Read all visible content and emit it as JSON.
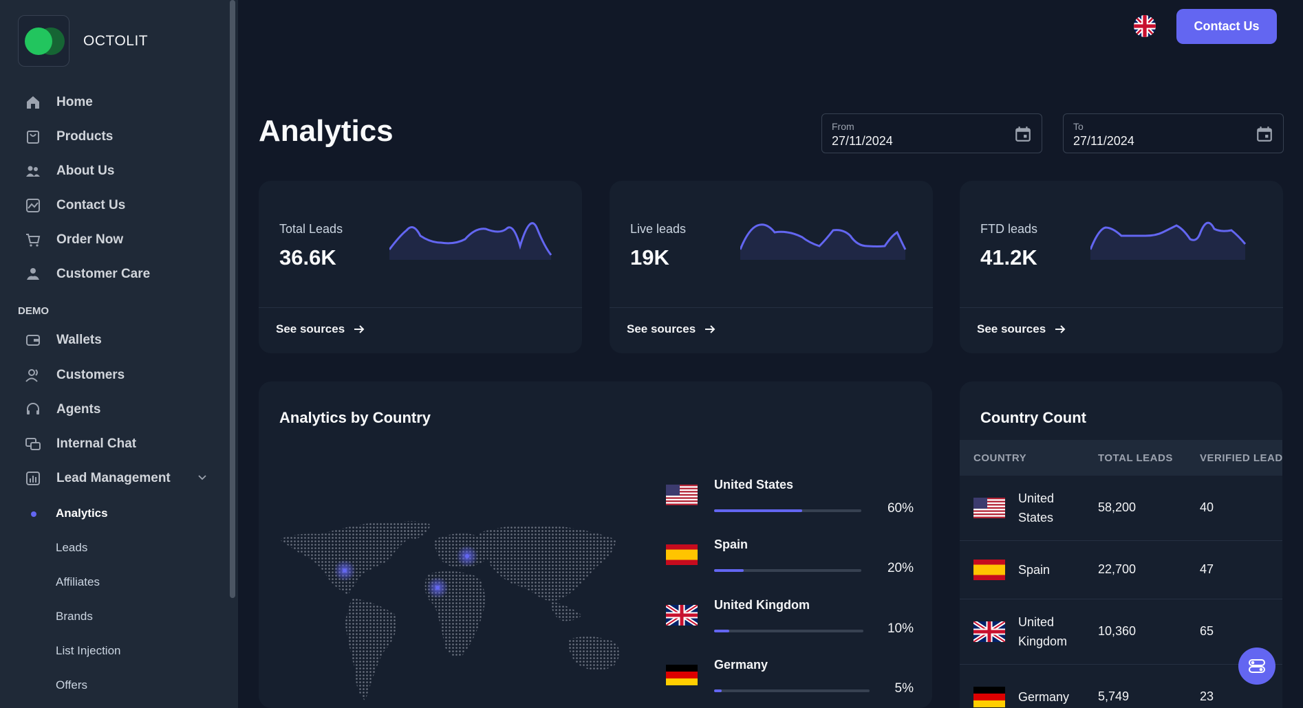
{
  "brand": {
    "name": "OCTOLIT"
  },
  "sidebar": {
    "main_items": [
      {
        "label": "Home",
        "icon": "home-icon"
      },
      {
        "label": "Products",
        "icon": "bag-icon"
      },
      {
        "label": "About Us",
        "icon": "users-icon"
      },
      {
        "label": "Contact Us",
        "icon": "chart-image-icon"
      },
      {
        "label": "Order Now",
        "icon": "cart-icon"
      },
      {
        "label": "Customer Care",
        "icon": "care-icon"
      }
    ],
    "section_label": "DEMO",
    "demo_items": [
      {
        "label": "Wallets",
        "icon": "wallet-icon"
      },
      {
        "label": "Customers",
        "icon": "customers-icon"
      },
      {
        "label": "Agents",
        "icon": "headset-icon"
      },
      {
        "label": "Internal Chat",
        "icon": "chat-icon"
      },
      {
        "label": "Lead Management",
        "icon": "bar-chart-icon"
      }
    ],
    "sub_items": [
      "Analytics",
      "Leads",
      "Affiliates",
      "Brands",
      "List Injection",
      "Offers"
    ]
  },
  "header": {
    "contact_button": "Contact Us",
    "language_flag": "uk-flag-icon"
  },
  "page": {
    "title": "Analytics"
  },
  "dates": {
    "from_label": "From",
    "from_value": "27/11/2024",
    "to_label": "To",
    "to_value": "27/11/2024"
  },
  "stats": [
    {
      "label": "Total Leads",
      "value": "36.6K",
      "link": "See sources"
    },
    {
      "label": "Live leads",
      "value": "19K",
      "link": "See sources"
    },
    {
      "label": "FTD leads",
      "value": "41.2K",
      "link": "See sources"
    }
  ],
  "by_country": {
    "title": "Analytics by Country",
    "rows": [
      {
        "country": "United States",
        "percent_label": "60%",
        "percent": 60,
        "flag": "us-flag-icon"
      },
      {
        "country": "Spain",
        "percent_label": "20%",
        "percent": 20,
        "flag": "spain-flag-icon"
      },
      {
        "country": "United Kingdom",
        "percent_label": "10%",
        "percent": 10,
        "flag": "uk-flag-icon"
      },
      {
        "country": "Germany",
        "percent_label": "5%",
        "percent": 5,
        "flag": "germany-flag-icon"
      }
    ]
  },
  "country_count": {
    "title": "Country Count",
    "headers": [
      "COUNTRY",
      "TOTAL LEADS",
      "VERIFIED LEADS"
    ],
    "rows": [
      {
        "country": "United States",
        "total": "58,200",
        "verified": "40"
      },
      {
        "country": "Spain",
        "total": "22,700",
        "verified": "47"
      },
      {
        "country": "United Kingdom",
        "total": "10,360",
        "verified": "65"
      },
      {
        "country": "Germany",
        "total": "5,749",
        "verified": "23"
      }
    ]
  },
  "colors": {
    "accent": "#6366f1",
    "background": "#111827",
    "sidebar": "#1f2937",
    "card": "#161f2e"
  }
}
